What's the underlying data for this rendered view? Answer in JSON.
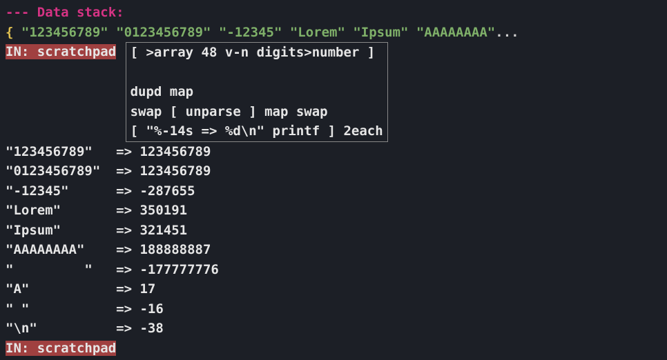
{
  "header": "--- Data stack:",
  "stack": {
    "brace": "{",
    "items": "\"123456789\" \"0123456789\" \"-12345\" \"Lorem\" \"Ipsum\" \"AAAAAAAA\"",
    "ellipsis": "..."
  },
  "prompt": "IN: scratchpad",
  "code": {
    "line1": "[ >array 48 v-n digits>number ]",
    "line2": "",
    "line3": "dupd map",
    "line4": "swap [ unparse ] map swap",
    "line5": "[ \"%-14s => %d\\n\" printf ] 2each"
  },
  "output": [
    {
      "input": "\"123456789\"   ",
      "arrow": "=>",
      "result": " 123456789"
    },
    {
      "input": "\"0123456789\"  ",
      "arrow": "=>",
      "result": " 123456789"
    },
    {
      "input": "\"-12345\"      ",
      "arrow": "=>",
      "result": " -287655"
    },
    {
      "input": "\"Lorem\"       ",
      "arrow": "=>",
      "result": " 350191"
    },
    {
      "input": "\"Ipsum\"       ",
      "arrow": "=>",
      "result": " 321451"
    },
    {
      "input": "\"AAAAAAAA\"    ",
      "arrow": "=>",
      "result": " 188888887"
    },
    {
      "input": "\"         \"   ",
      "arrow": "=>",
      "result": " -177777776"
    },
    {
      "input": "\"A\"           ",
      "arrow": "=>",
      "result": " 17"
    },
    {
      "input": "\" \"           ",
      "arrow": "=>",
      "result": " -16"
    },
    {
      "input": "\"\\n\"          ",
      "arrow": "=>",
      "result": " -38"
    }
  ]
}
